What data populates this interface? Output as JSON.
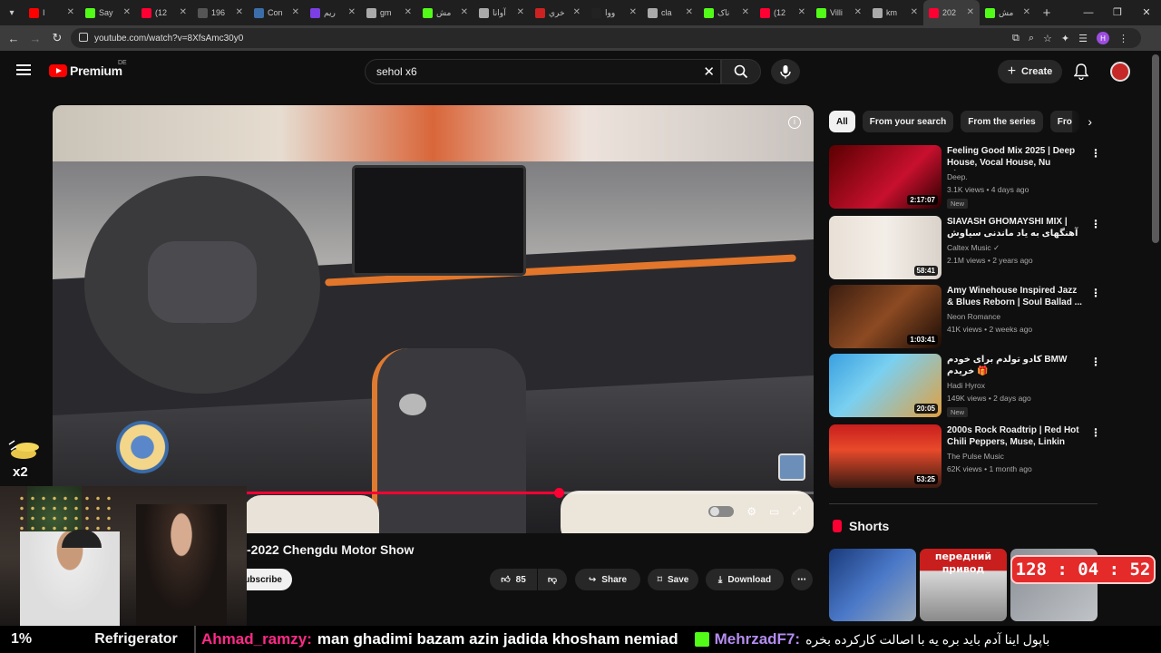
{
  "browser": {
    "tabs": [
      {
        "label": "I",
        "color": "#ff0000"
      },
      {
        "label": "Say",
        "color": "#53fc18"
      },
      {
        "label": "(12",
        "color": "#ff0033"
      },
      {
        "label": "196",
        "color": "#555555"
      },
      {
        "label": "Con",
        "color": "#3b6ea8"
      },
      {
        "label": "ريم",
        "color": "#7b3fe4"
      },
      {
        "label": "gm",
        "color": "#aaaaaa"
      },
      {
        "label": "مش",
        "color": "#53fc18"
      },
      {
        "label": "آوانا",
        "color": "#aaaaaa"
      },
      {
        "label": "خري",
        "color": "#cc2222"
      },
      {
        "label": "ووا",
        "color": "#222222"
      },
      {
        "label": "cla",
        "color": "#aaaaaa"
      },
      {
        "label": "ناک",
        "color": "#53fc18"
      },
      {
        "label": "(12",
        "color": "#ff0033"
      },
      {
        "label": "Villi",
        "color": "#53fc18"
      },
      {
        "label": "km",
        "color": "#aaaaaa"
      },
      {
        "label": "202",
        "color": "#ff0033",
        "active": true
      },
      {
        "label": "مش",
        "color": "#53fc18"
      }
    ],
    "url": "youtube.com/watch?v=8XfsAmc30y0",
    "profile_initial": "H",
    "new_tab": "+",
    "window_controls": [
      "—",
      "❐",
      "✕"
    ]
  },
  "youtube": {
    "logo_text": "Premium",
    "country_code": "DE",
    "search_query": "sehol x6",
    "create_label": "Create",
    "video": {
      "title": "-2022 Chengdu Motor Show",
      "progress_fraction": 0.665,
      "subscribe_label": "ubscribe",
      "like_count": "85",
      "share_label": "Share",
      "save_label": "Save",
      "download_label": "Download"
    },
    "chips": [
      {
        "label": "All",
        "active": true
      },
      {
        "label": "From your search"
      },
      {
        "label": "From the series"
      },
      {
        "label": "Fro"
      }
    ],
    "recommendations": [
      {
        "title": "Feeling Good Mix 2025 | Deep House, Vocal House, Nu Disco,...",
        "channel": "Deep.",
        "meta": "3.1K views • 4 days ago",
        "badge": "New",
        "duration": "2:17:07",
        "thumb": "linear-gradient(135deg,#5a0000,#c8102e 60%,#2a0000)"
      },
      {
        "title": "SIAVASH GHOMAYSHI MIX | آهنگهای به یاد ماندنی سیاوش قمیشی",
        "channel": "Caltex Music ✓",
        "meta": "2.1M views • 2 years ago",
        "badge": "",
        "duration": "58:41",
        "thumb": "linear-gradient(90deg,#e8e0d6,#f4eee8 50%,#d9d2ca)"
      },
      {
        "title": "Amy Winehouse Inspired Jazz & Blues Reborn | Soul Ballad ...",
        "channel": "Neon Romance",
        "meta": "41K views • 2 weeks ago",
        "badge": "",
        "duration": "1:03:41",
        "thumb": "linear-gradient(135deg,#3a1d10,#8c4a22 50%,#1a0c06)"
      },
      {
        "title": "کادو تولدم برای خودم BMW خریدم 🎁",
        "channel": "Hadi Hyrox",
        "meta": "149K views • 2 days ago",
        "badge": "New",
        "duration": "20:05",
        "thumb": "linear-gradient(135deg,#3aa0e0,#7ad0f0 40%,#e0a040)"
      },
      {
        "title": "2000s Rock Roadtrip | Red Hot Chili Peppers, Muse, Linkin Pa...",
        "channel": "The Pulse Music",
        "meta": "62K views • 1 month ago",
        "badge": "",
        "duration": "53:25",
        "thumb": "linear-gradient(180deg,#c81e1e,#e84a2a 40%,#3a1a12)"
      }
    ],
    "shorts_label": "Shorts",
    "shorts": [
      {
        "text": "",
        "thumb": "linear-gradient(135deg,#1a3a7a,#4a78c8 50%,#9aa8b8)"
      },
      {
        "text": "передний привод",
        "thumb": "linear-gradient(180deg,#c81e1e 0%,#c81e1e 30%,#d8d8d8 31%,#8a8a8a)"
      },
      {
        "text": "",
        "thumb": "linear-gradient(135deg,#8a8f96,#c0c4c8)"
      }
    ]
  },
  "stream_overlay": {
    "tip_multiplier": "x2",
    "timer": "128 : 04 : 52",
    "ticker_percent": "1%",
    "ticker_label": "Refrigerator",
    "chat": [
      {
        "user": "Ahmad_ramzy:",
        "message": "man ghadimi bazam azin jadida khosham nemiad"
      },
      {
        "user": "MehrzadF7:",
        "message": "باپول اینا آدم باید بره یه با اصالت کارکرده بخره"
      }
    ]
  }
}
